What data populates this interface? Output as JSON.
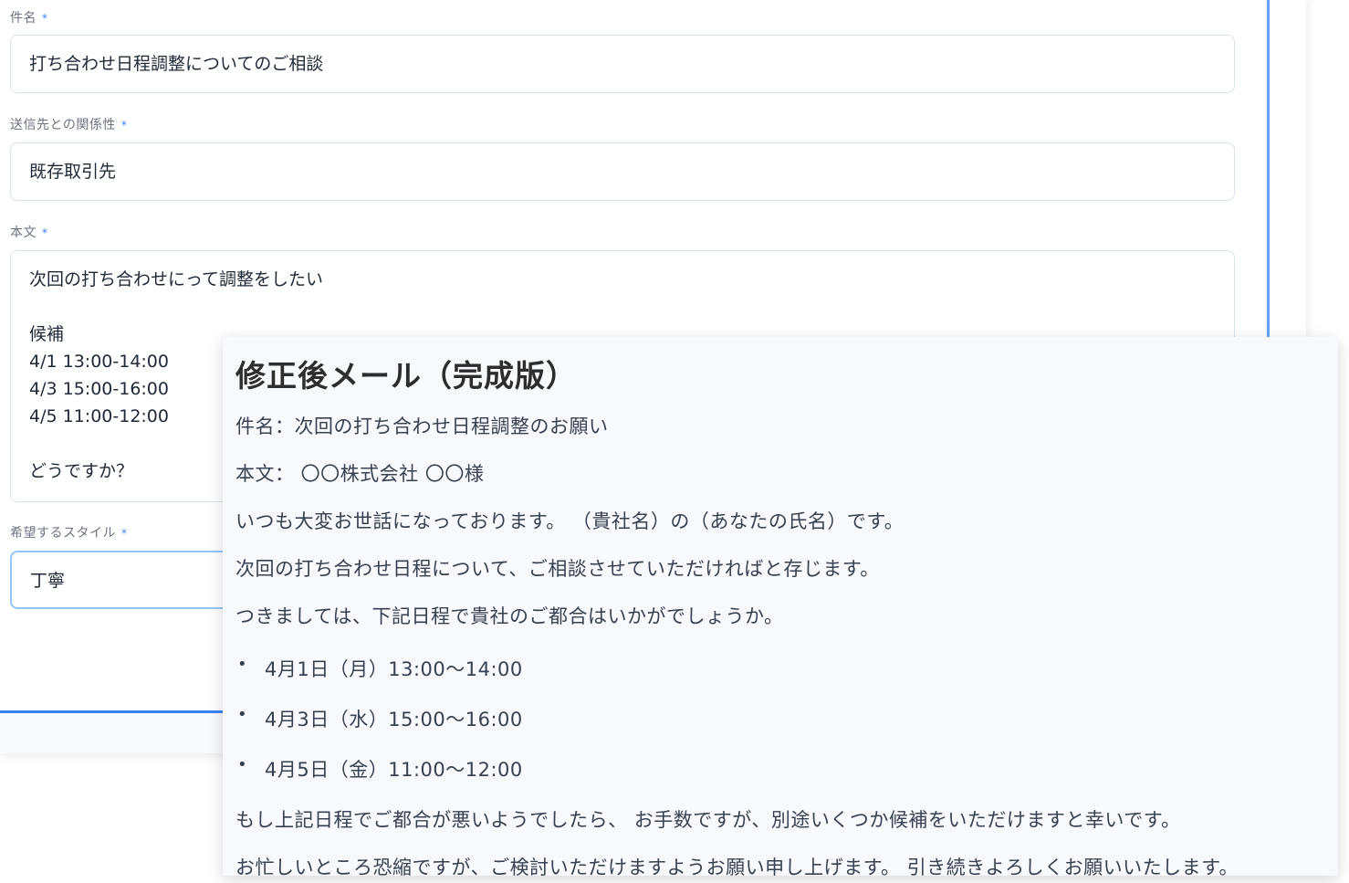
{
  "form": {
    "subject": {
      "label": "件名",
      "required_mark": "*",
      "value": "打ち合わせ日程調整についてのご相談"
    },
    "relationship": {
      "label": "送信先との関係性",
      "required_mark": "*",
      "value": "既存取引先"
    },
    "body": {
      "label": "本文",
      "required_mark": "*",
      "value": "次回の打ち合わせにって調整をしたい\n\n候補\n4/1 13:00-14:00\n4/3 15:00-16:00\n4/5 11:00-12:00\n\nどうですか？"
    },
    "style": {
      "label": "希望するスタイル",
      "required_mark": "*",
      "value": "丁寧"
    }
  },
  "result": {
    "title": "修正後メール（完成版）",
    "subject_line": "件名：次回の打ち合わせ日程調整のお願い",
    "body_line": "本文： 〇〇株式会社 〇〇様",
    "greeting": "いつも大変お世話になっております。 （貴社名）の（あなたの氏名）です。",
    "intro": "次回の打ち合わせ日程について、ご相談させていただければと存じます。",
    "ask": "つきましては、下記日程で貴社のご都合はいかがでしょうか。",
    "bullet_char": "•",
    "candidates": [
      "4月1日（月）13:00〜14:00",
      "4月3日（水）15:00〜16:00",
      "4月5日（金）11:00〜12:00"
    ],
    "fallback": "もし上記日程でご都合が悪いようでしたら、 お手数ですが、別途いくつか候補をいただけますと幸いです。",
    "closing": "お忙しいところ恐縮ですが、ご検討いただけますようお願い申し上げます。 引き続きよろしくお願いいたします。"
  },
  "colors": {
    "accent": "#3b82f6",
    "required": "#3b82f6",
    "panel_bg": "#f8f9fc"
  }
}
